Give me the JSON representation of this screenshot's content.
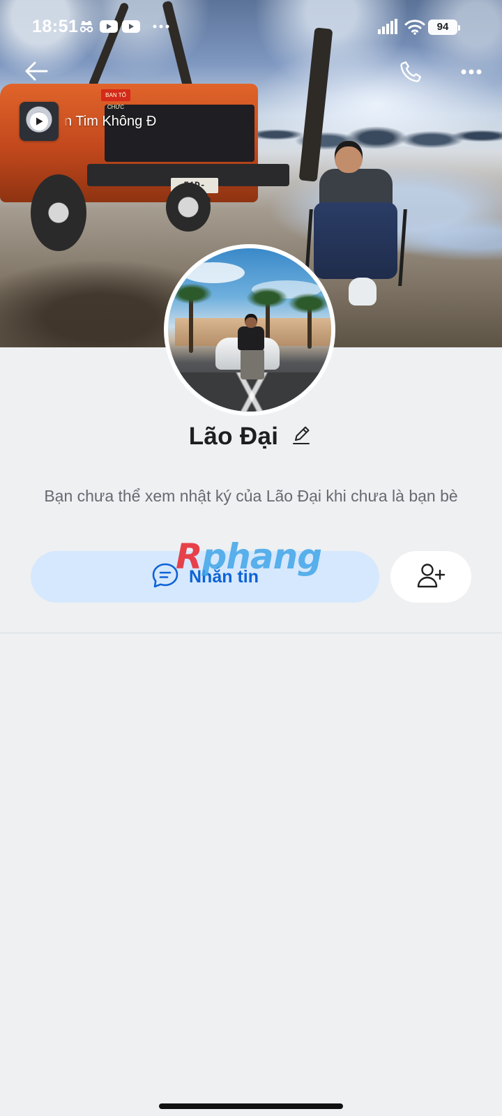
{
  "status_bar": {
    "time": "18:51",
    "battery": "94",
    "icons": [
      "incognito-icon",
      "youtube-icon",
      "youtube-icon",
      "more-dots-icon",
      "signal-icon",
      "wifi-icon",
      "battery-icon"
    ]
  },
  "header": {
    "back_icon": "arrow-left-icon",
    "call_icon": "phone-icon",
    "more_icon": "more-horizontal-icon"
  },
  "cover": {
    "plate_text": "51D-485.10",
    "plate_label": "BAN TỔ CHỨC"
  },
  "music": {
    "title": "n Tim Không Đ"
  },
  "profile": {
    "name": "Lão Đại",
    "notice": "Bạn chưa thể xem nhật ký của Lão Đại khi chưa là bạn bè"
  },
  "actions": {
    "message_label": "Nhắn tin",
    "message_icon": "chat-bubble-icon",
    "add_friend_icon": "user-add-icon"
  },
  "watermark": {
    "first": "R",
    "rest": "phang"
  },
  "colors": {
    "page_bg": "#eef0f2",
    "accent": "#0d63d6",
    "message_button_bg": "#d6e8fd"
  }
}
